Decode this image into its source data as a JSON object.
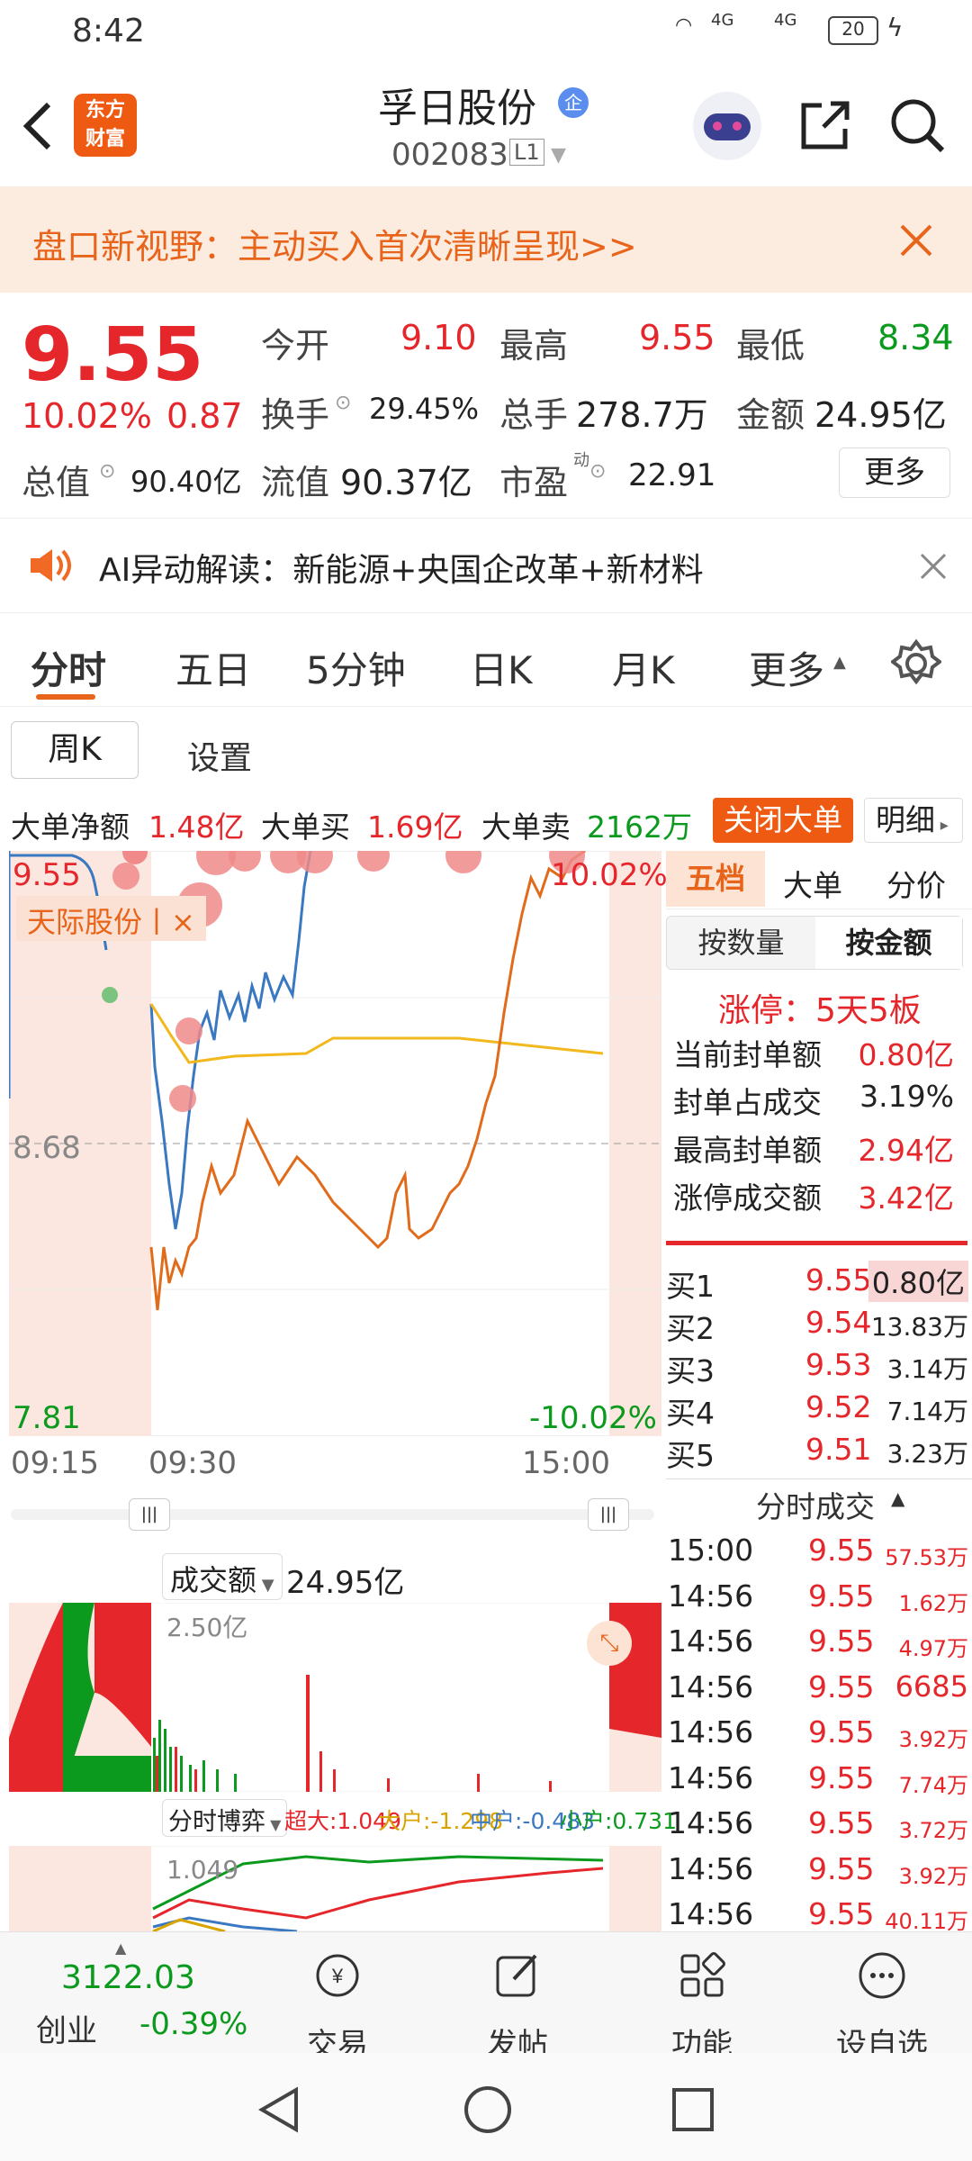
{
  "status": {
    "time": "8:42",
    "signal1": "4G",
    "signal2": "4G",
    "battery": "20"
  },
  "header": {
    "logo_line1": "东方",
    "logo_line2": "财富",
    "stock_name": "孚日股份",
    "stock_badge": "企",
    "stock_code": "002083",
    "level": "L1"
  },
  "banner": {
    "text": "盘口新视野：主动买入首次清晰呈现>>"
  },
  "quote": {
    "price": "9.55",
    "pct": "10.02%",
    "chg": "0.87",
    "open_label": "今开",
    "open": "9.10",
    "high_label": "最高",
    "high": "9.55",
    "low_label": "最低",
    "low": "8.34",
    "turnover_label": "换手",
    "turnover": "29.45%",
    "volume_label": "总手",
    "volume": "278.7万",
    "amount_label": "金额",
    "amount": "24.95亿",
    "mcap_label": "总值",
    "mcap": "90.40亿",
    "float_label": "流值",
    "float": "90.37亿",
    "pe_label": "市盈",
    "pe_sup": "动",
    "pe": "22.91",
    "more_btn": "更多"
  },
  "ai": {
    "text": "AI异动解读：新能源+央国企改革+新材料"
  },
  "tabs": [
    "分时",
    "五日",
    "5分钟",
    "日K",
    "月K",
    "更多"
  ],
  "subtabs": {
    "weekk": "周K",
    "settings": "设置"
  },
  "blockinfo": {
    "net_label": "大单净额",
    "net": "1.48亿",
    "buy_label": "大单买",
    "buy": "1.69亿",
    "sell_label": "大单卖",
    "sell": "2162万",
    "close_btn": "关闭大单",
    "detail_btn": "明细"
  },
  "chart": {
    "top_price": "9.55",
    "mid_price": "8.68",
    "bottom_price": "7.81",
    "top_pct": "10.02%",
    "bottom_pct": "-10.02%",
    "overlay_label": "天际股份丨×",
    "t_start": "09:15",
    "t_open": "09:30",
    "t_end": "15:00",
    "vol_label": "成交额",
    "vol_value": "24.95亿",
    "vol_max": "2.50亿",
    "game_label": "分时博弈",
    "game_super": "超大:1.049",
    "game_big": "大户:-1.298",
    "game_mid": "中户:-0.483",
    "game_small": "小户:0.731",
    "game_top": "1.049"
  },
  "right": {
    "tabs": [
      "五档",
      "大单",
      "分价"
    ],
    "toggle": [
      "按数量",
      "按金额"
    ],
    "limit_title": "涨停：5天5板",
    "stats": [
      {
        "label": "当前封单额",
        "value": "0.80亿",
        "color": "#e5262b"
      },
      {
        "label": "封单占成交",
        "value": "3.19%",
        "color": "#222"
      },
      {
        "label": "最高封单额",
        "value": "2.94亿",
        "color": "#e5262b"
      },
      {
        "label": "涨停成交额",
        "value": "3.42亿",
        "color": "#e5262b"
      }
    ],
    "bids": [
      {
        "label": "买1",
        "price": "9.55",
        "vol": "0.80亿"
      },
      {
        "label": "买2",
        "price": "9.54",
        "vol": "13.83万"
      },
      {
        "label": "买3",
        "price": "9.53",
        "vol": "3.14万"
      },
      {
        "label": "买4",
        "price": "9.52",
        "vol": "7.14万"
      },
      {
        "label": "买5",
        "price": "9.51",
        "vol": "3.23万"
      }
    ],
    "ticks_title": "分时成交",
    "ticks": [
      {
        "t": "15:00",
        "p": "9.55",
        "v": "57.53万"
      },
      {
        "t": "14:56",
        "p": "9.55",
        "v": "1.62万"
      },
      {
        "t": "14:56",
        "p": "9.55",
        "v": "4.97万"
      },
      {
        "t": "14:56",
        "p": "9.55",
        "v": "6685"
      },
      {
        "t": "14:56",
        "p": "9.55",
        "v": "3.92万"
      },
      {
        "t": "14:56",
        "p": "9.55",
        "v": "7.74万"
      },
      {
        "t": "14:56",
        "p": "9.55",
        "v": "3.72万"
      },
      {
        "t": "14:56",
        "p": "9.55",
        "v": "3.92万"
      },
      {
        "t": "14:56",
        "p": "9.55",
        "v": "40.11万"
      }
    ]
  },
  "bottom": {
    "index_value": "3122.03",
    "index_name": "创业",
    "index_pct": "-0.39%",
    "trade": "交易",
    "post": "发帖",
    "func": "功能",
    "watch": "设自选"
  }
}
